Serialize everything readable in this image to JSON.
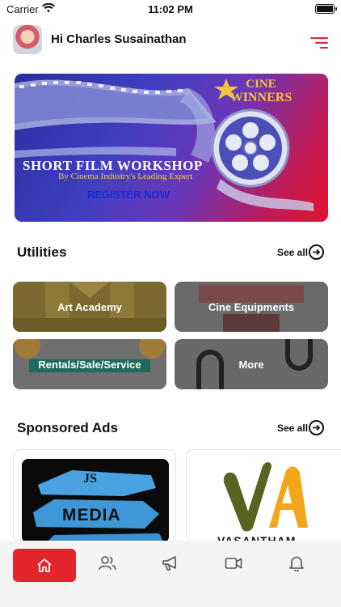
{
  "status_bar": {
    "carrier": "Carrier",
    "time": "11:02 PM"
  },
  "header": {
    "greeting": "Hi Charles Susainathan"
  },
  "banner": {
    "brand_line1": "CINE",
    "brand_line2": "WINNERS",
    "title": "SHORT FILM WORKSHOP",
    "subtitle": "By Cinema Industry's Leading Expert",
    "cta": "REGISTER NOW"
  },
  "utilities": {
    "title": "Utilities",
    "see_all": "See all",
    "tiles": [
      {
        "label": "Art Academy",
        "color": "#7c6a2a"
      },
      {
        "label": "Cine Equipments",
        "color": "#6b6b6b"
      },
      {
        "label": "Rentals/Sale/Service",
        "color": "#6e6e6e"
      },
      {
        "label": "More",
        "color": "#6a6a6a"
      }
    ]
  },
  "sponsored": {
    "title": "Sponsored Ads",
    "see_all": "See all",
    "ads": [
      {
        "line1": "JS",
        "line2": "MEDIA"
      },
      {
        "logo": "VA",
        "name": "VASANTHAM"
      }
    ]
  },
  "nav": {
    "items": [
      "home-icon",
      "users-icon",
      "megaphone-icon",
      "video-icon",
      "bell-icon"
    ]
  },
  "colors": {
    "accent": "#e4252d",
    "banner_blue": "#2b2ea0",
    "banner_red": "#e2132c"
  }
}
